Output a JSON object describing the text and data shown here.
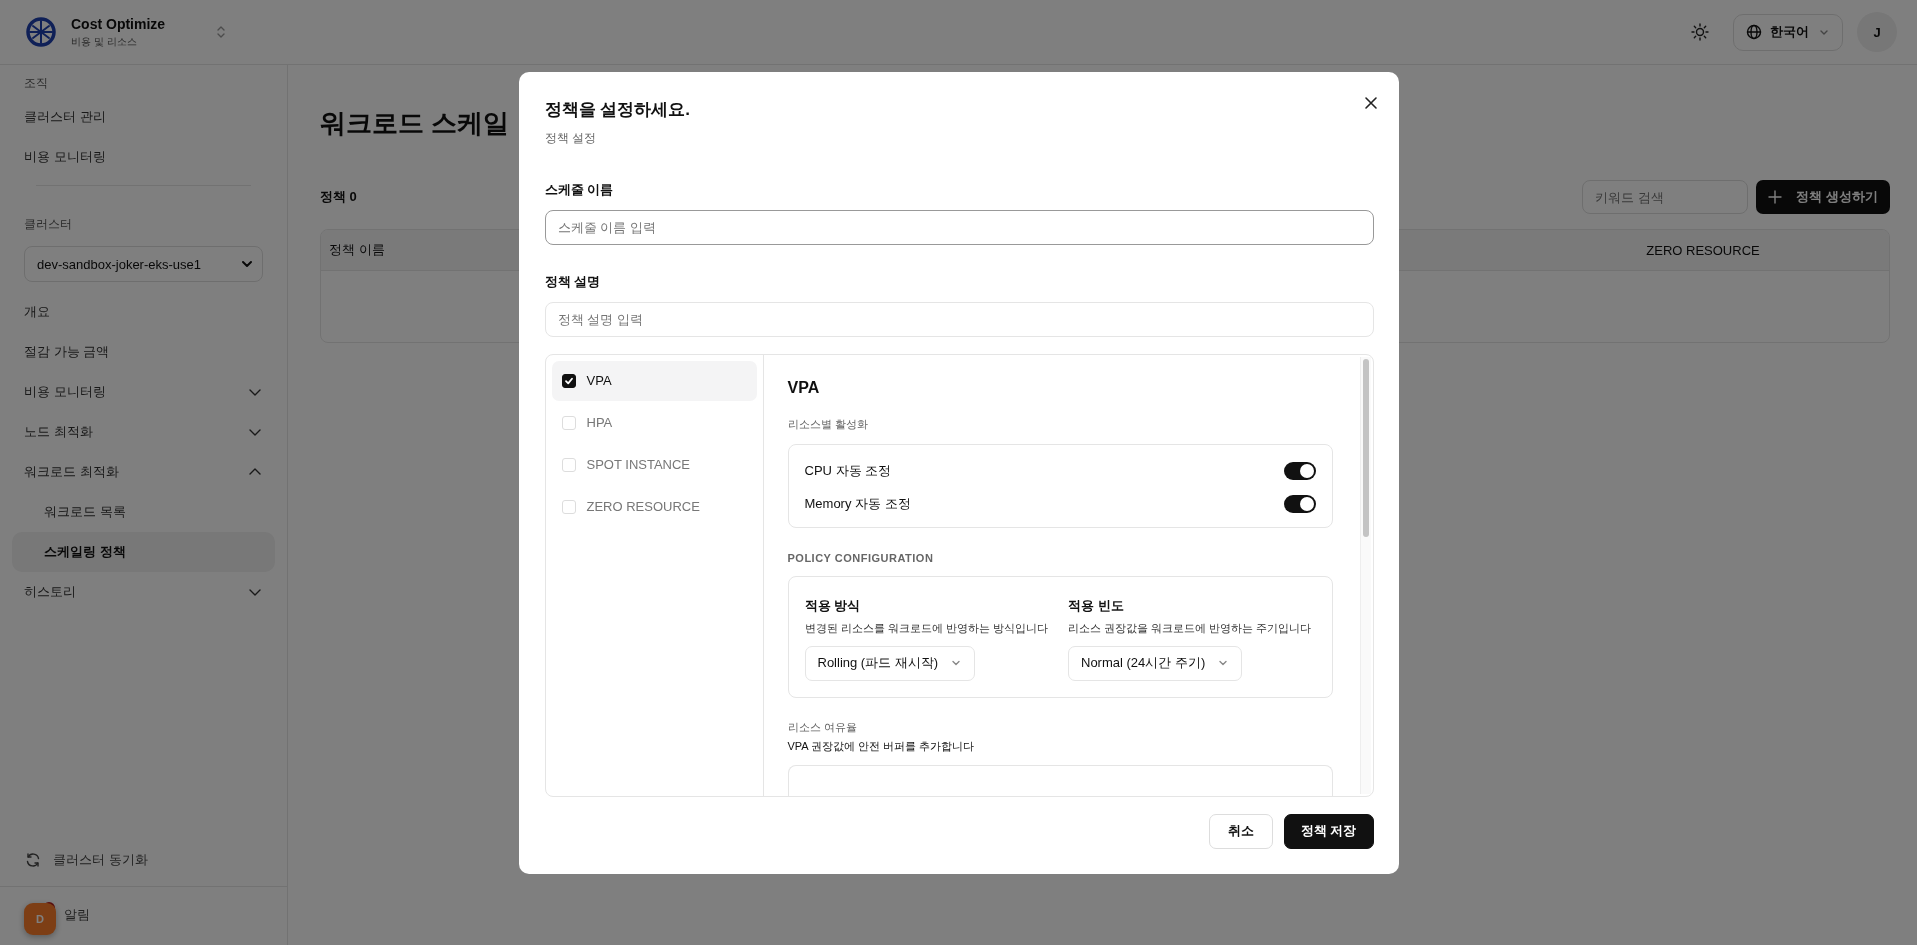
{
  "header": {
    "app_name": "Cost Optimize",
    "app_subtitle": "비용 및 리소스",
    "language": "한국어",
    "avatar": "J"
  },
  "sidebar": {
    "org_label": "조직",
    "org_items": [
      {
        "label": "클러스터 관리"
      },
      {
        "label": "비용 모니터링"
      }
    ],
    "cluster_label": "클러스터",
    "cluster_select": "dev-sandbox-joker-eks-use1",
    "nav": [
      {
        "label": "개요",
        "kind": "link",
        "selected": false
      },
      {
        "label": "절감 가능 금액",
        "kind": "link",
        "selected": false
      },
      {
        "label": "비용 모니터링",
        "kind": "group",
        "selected": false,
        "expanded": false
      },
      {
        "label": "노드 최적화",
        "kind": "group",
        "selected": false,
        "expanded": false
      },
      {
        "label": "워크로드 최적화",
        "kind": "group",
        "selected": false,
        "expanded": true,
        "children": [
          {
            "label": "워크로드 목록",
            "kind": "link",
            "selected": false
          },
          {
            "label": "스케일링 정책",
            "kind": "link",
            "selected": true
          }
        ]
      },
      {
        "label": "히스토리",
        "kind": "group",
        "selected": false,
        "expanded": false
      }
    ],
    "sync_label": "클러스터 동기화",
    "notifications_label": "알림",
    "dev_badge": "D"
  },
  "page": {
    "title": "워크로드 스케일",
    "count_label": "정책 0",
    "search": {
      "placeholder": "키워드 검색"
    },
    "create_button": "정책 생성하기",
    "table": {
      "columns": [
        "정책 이름",
        "ZERO RESOURCE"
      ]
    }
  },
  "modal": {
    "title": "정책을 설정하세요.",
    "subtitle": "정책 설정",
    "fields": [
      {
        "label": "스케줄 이름",
        "placeholder": "스케줄 이름 입력",
        "focused": true
      },
      {
        "label": "정책 설명",
        "placeholder": "정책 설명 입력",
        "focused": false
      }
    ],
    "policy_types": [
      {
        "label": "VPA",
        "checked": true,
        "selected": true
      },
      {
        "label": "HPA",
        "checked": false,
        "selected": false
      },
      {
        "label": "SPOT INSTANCE",
        "checked": false,
        "selected": false
      },
      {
        "label": "ZERO RESOURCE",
        "checked": false,
        "selected": false
      }
    ],
    "detail": {
      "title": "VPA",
      "resource_label": "리소스별 활성화",
      "toggles": [
        {
          "label": "CPU 자동 조정",
          "on": true
        },
        {
          "label": "Memory 자동 조정",
          "on": true
        }
      ],
      "config_label": "POLICY CONFIGURATION",
      "settings": [
        {
          "label": "적용 방식",
          "description": "변경된 리소스를 워크로드에 반영하는 방식입니다",
          "value": "Rolling (파드 재시작)"
        },
        {
          "label": "적용 빈도",
          "description": "리소스 권장값을 워크로드에 반영하는 주기입니다",
          "value": "Normal (24시간 주기)"
        }
      ],
      "buffer_label": "리소스 여유율",
      "buffer_description": "VPA 권장값에 안전 버퍼를 추가합니다"
    },
    "buttons": [
      {
        "label": "취소",
        "kind": "secondary"
      },
      {
        "label": "정책 저장",
        "kind": "primary"
      }
    ]
  }
}
